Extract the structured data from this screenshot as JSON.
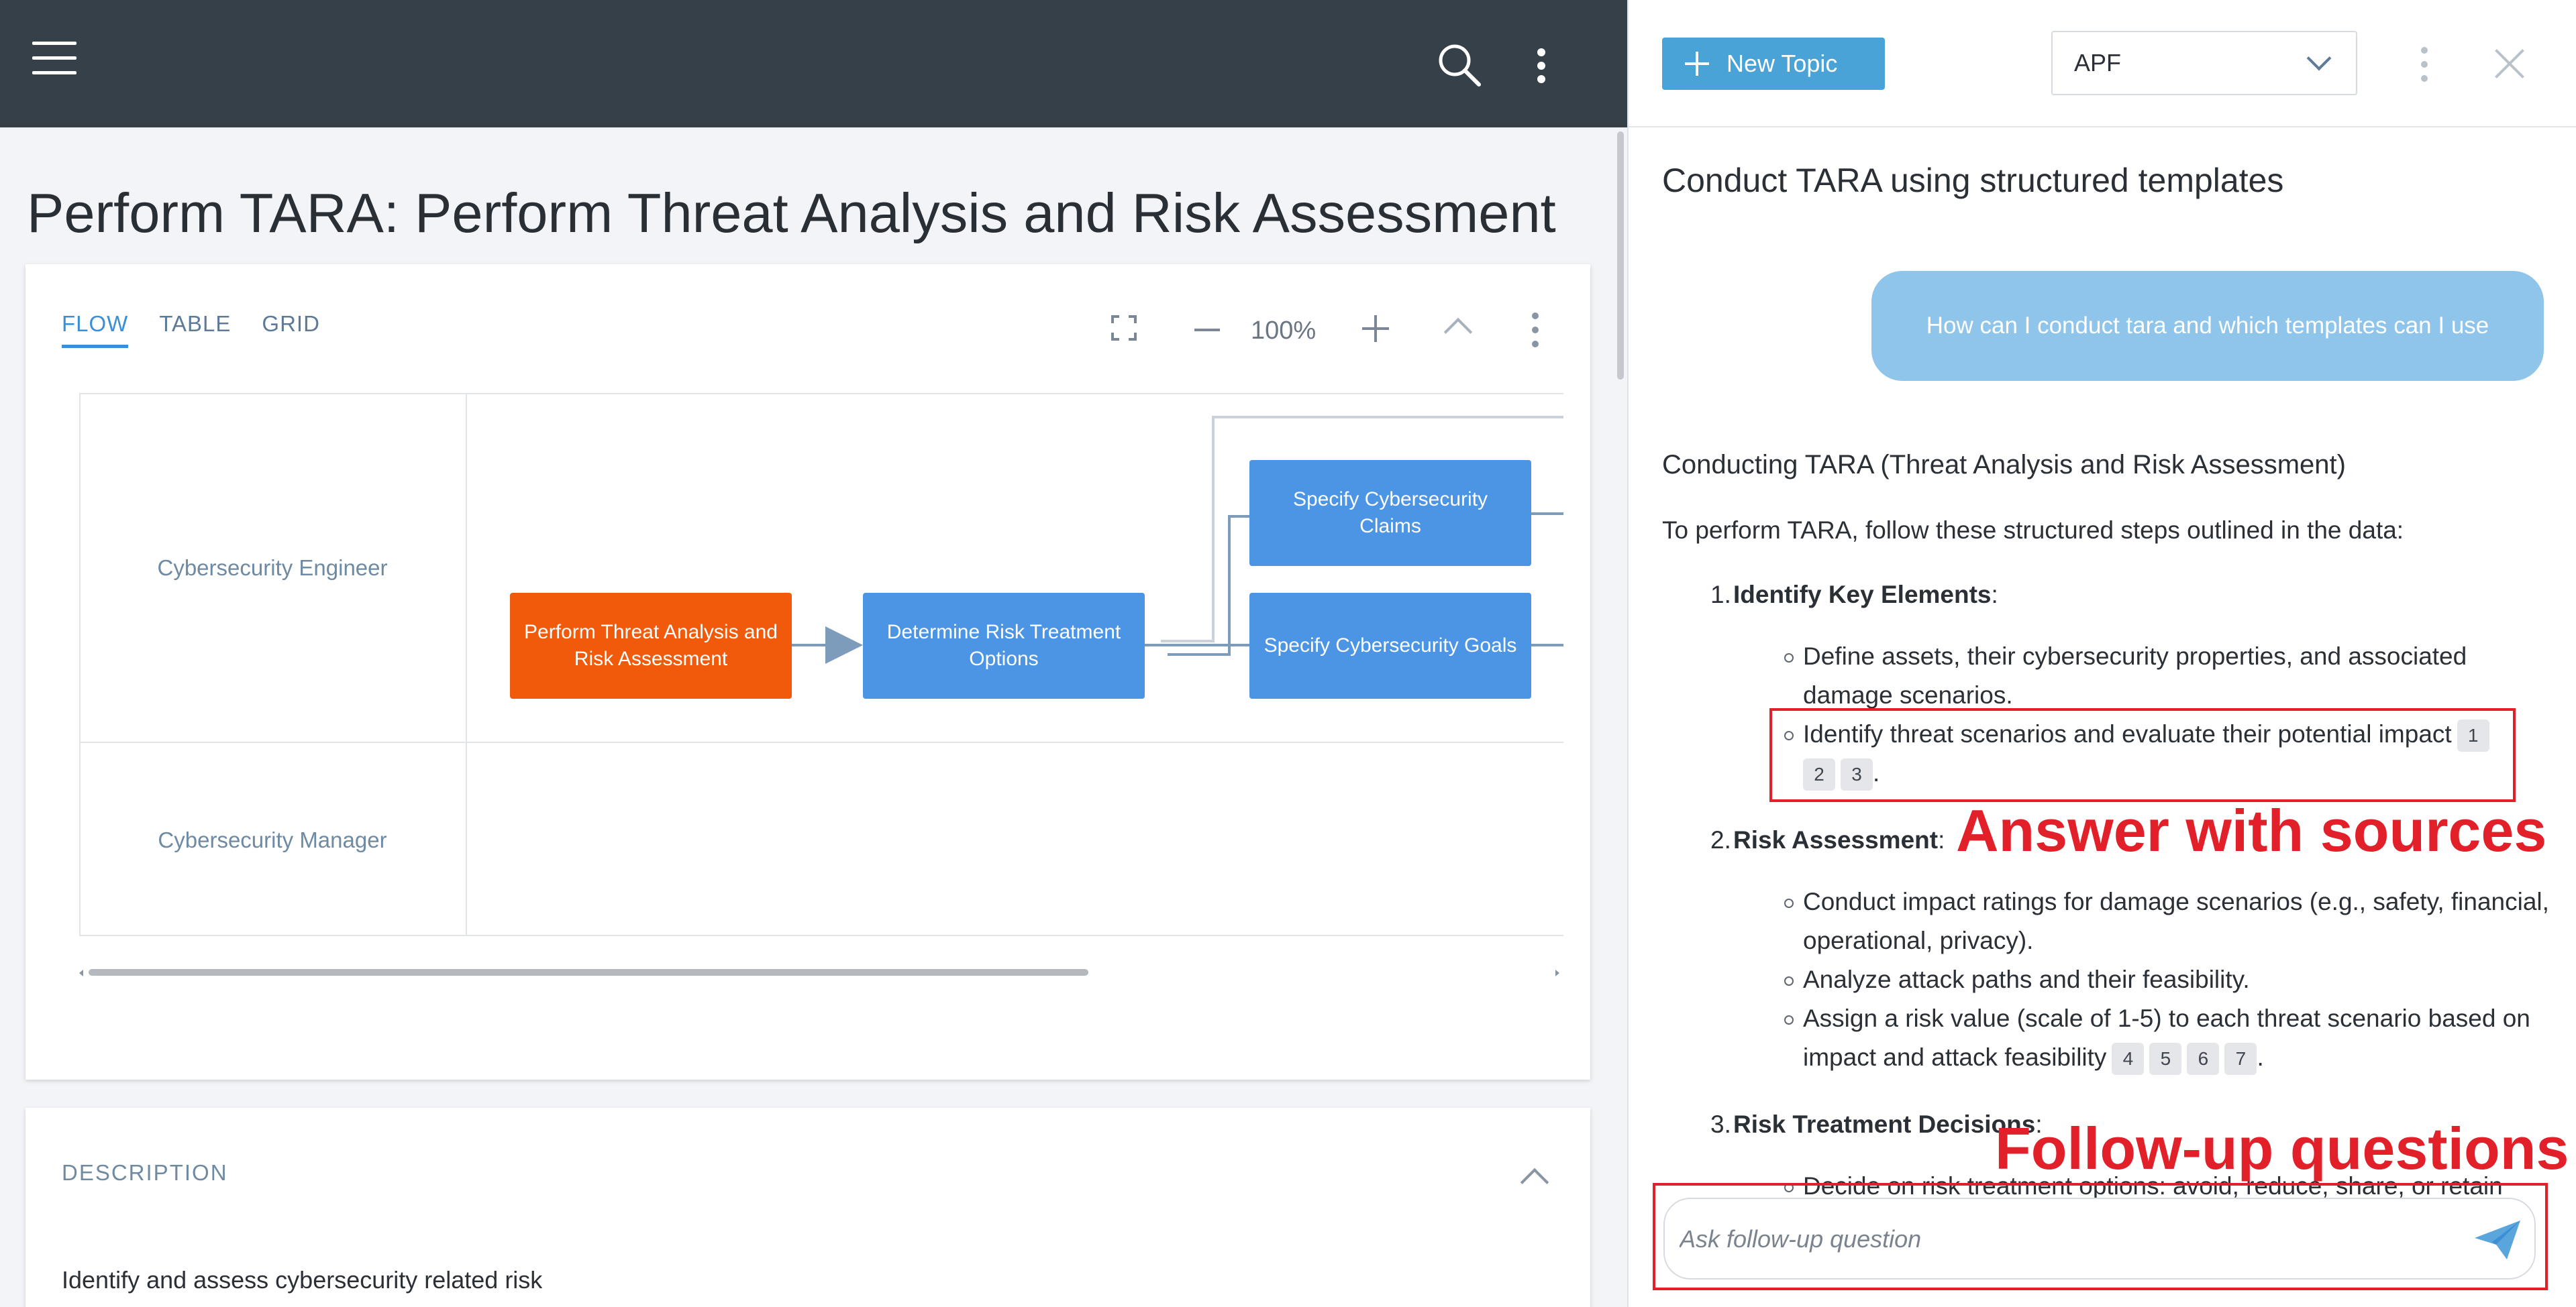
{
  "left": {
    "page_title": "Perform TARA: Perform Threat Analysis and Risk Assessment",
    "tabs": [
      "FLOW",
      "TABLE",
      "GRID"
    ],
    "active_tab": "FLOW",
    "zoom": "100%",
    "lanes": [
      "Cybersecurity Engineer",
      "Cybersecurity Manager"
    ],
    "nodes": [
      {
        "label": "Perform Threat Analysis and Risk Assessment",
        "color": "#f05a0a"
      },
      {
        "label": "Determine Risk Treatment Options",
        "color": "#4b95e4"
      },
      {
        "label": "Specify Cybersecurity Claims",
        "color": "#4b95e4"
      },
      {
        "label": "Specify Cybersecurity Goals",
        "color": "#4b95e4"
      }
    ],
    "description": {
      "title": "DESCRIPTION",
      "text": "Identify and assess cybersecurity related risk"
    }
  },
  "chat": {
    "new_topic_label": "New Topic",
    "selected_source": "APF",
    "topic_title": "Conduct TARA using structured templates",
    "user_question": "How can I conduct tara and which templates can I use",
    "answer": {
      "heading": "Conducting TARA (Threat Analysis and Risk Assessment)",
      "intro": "To perform TARA, follow these structured steps outlined in the data:",
      "steps": [
        {
          "num": "1.",
          "title": "Identify Key Elements",
          "suffix": ":",
          "bullets": [
            {
              "text": "Define assets, their cybersecurity properties, and associated damage scenarios.",
              "sources": []
            },
            {
              "text": "Identify threat scenarios and evaluate their potential impact",
              "sources": [
                "1",
                "2",
                "3"
              ],
              "end": "."
            }
          ]
        },
        {
          "num": "2.",
          "title": "Risk Assessment",
          "suffix": ":",
          "bullets": [
            {
              "text": "Conduct impact ratings for damage scenarios (e.g., safety, financial, operational, privacy).",
              "sources": []
            },
            {
              "text": "Analyze attack paths and their feasibility.",
              "sources": []
            },
            {
              "text": "Assign a risk value (scale of 1-5) to each threat scenario based on impact and attack feasibility",
              "sources": [
                "4",
                "5",
                "6",
                "7"
              ],
              "end": "."
            }
          ]
        },
        {
          "num": "3.",
          "title": "Risk Treatment Decisions",
          "suffix": ":",
          "bullets": [
            {
              "text": "Decide on risk treatment options: avoid, reduce, share, or retain",
              "sources": []
            }
          ]
        }
      ]
    },
    "followup_placeholder": "Ask follow-up question"
  },
  "annotations": {
    "answer_label": "Answer with sources",
    "followup_label": "Follow-up questions",
    "color": "#e2202a"
  },
  "colors": {
    "topbar": "#364049",
    "accent": "#3c8fd6",
    "node_active": "#f05a0a",
    "node": "#4b95e4",
    "user_bubble": "#8fc5eb",
    "new_topic_button": "#4aa3d6"
  },
  "icons": [
    "menu-icon",
    "search-icon",
    "more-vertical-icon",
    "fullscreen-icon",
    "zoom-out-icon",
    "zoom-in-icon",
    "chevron-up-icon",
    "plus-icon",
    "chevron-down-icon",
    "close-icon",
    "send-icon"
  ]
}
